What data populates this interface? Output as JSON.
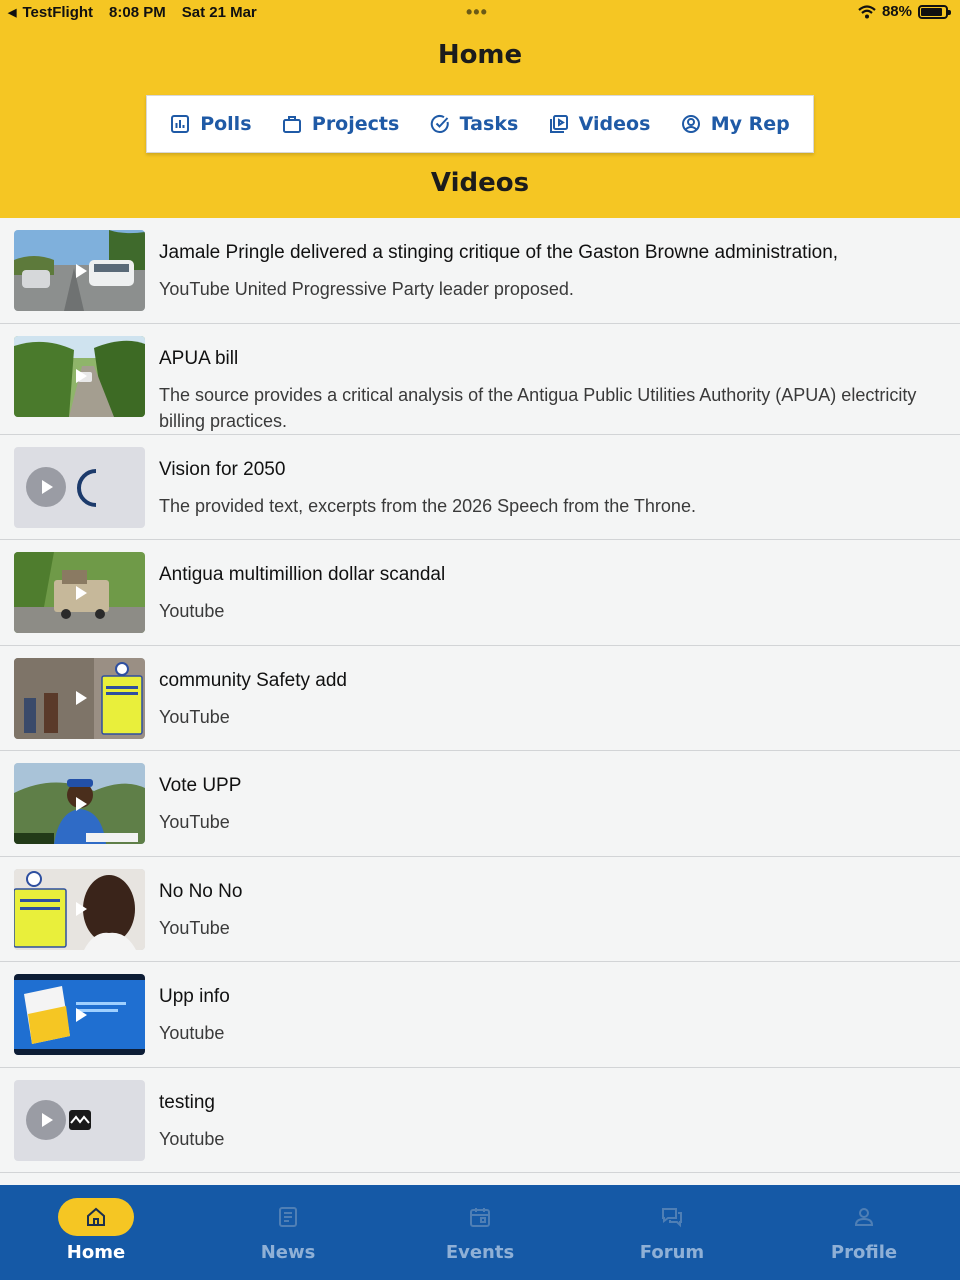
{
  "status_bar": {
    "back_app": "TestFlight",
    "time": "8:08 PM",
    "date": "Sat 21 Mar",
    "battery": "88%",
    "battery_level": 0.88
  },
  "header": {
    "title": "Home",
    "section_title": "Videos"
  },
  "segments": [
    {
      "label": "Polls",
      "icon": "bar-chart-icon"
    },
    {
      "label": "Projects",
      "icon": "briefcase-icon"
    },
    {
      "label": "Tasks",
      "icon": "check-circle-icon"
    },
    {
      "label": "Videos",
      "icon": "video-library-icon"
    },
    {
      "label": "My Rep",
      "icon": "user-circle-icon"
    }
  ],
  "videos": [
    {
      "title": "Jamale Pringle delivered a stinging critique of the Gaston Browne administration,",
      "description": "YouTube United Progressive Party leader proposed.",
      "thumb": "street-cars"
    },
    {
      "title": "APUA bill",
      "description": "The source provides a critical analysis of the Antigua Public Utilities Authority (APUA) electricity billing practices.",
      "thumb": "country-road"
    },
    {
      "title": "Vision for 2050",
      "description": "The provided text, excerpts from the 2026 Speech from the Throne.",
      "thumb": "placeholder-loading"
    },
    {
      "title": " Antigua multimillion dollar scandal",
      "description": "Youtube",
      "thumb": "truck-road"
    },
    {
      "title": "community Safety add",
      "description": "YouTube",
      "thumb": "community-poster"
    },
    {
      "title": "Vote UPP",
      "description": "YouTube",
      "thumb": "man-blue-shirt"
    },
    {
      "title": "No No No",
      "description": "YouTube",
      "thumb": "youth-poster"
    },
    {
      "title": "Upp info",
      "description": "Youtube",
      "thumb": "info-brochure"
    },
    {
      "title": "testing",
      "description": "Youtube",
      "thumb": "placeholder-image"
    }
  ],
  "tabs": [
    {
      "label": "Home",
      "icon": "home-icon",
      "active": true
    },
    {
      "label": "News",
      "icon": "newspaper-icon",
      "active": false
    },
    {
      "label": "Events",
      "icon": "calendar-icon",
      "active": false
    },
    {
      "label": "Forum",
      "icon": "chat-bubbles-icon",
      "active": false
    },
    {
      "label": "Profile",
      "icon": "person-icon",
      "active": false
    }
  ]
}
